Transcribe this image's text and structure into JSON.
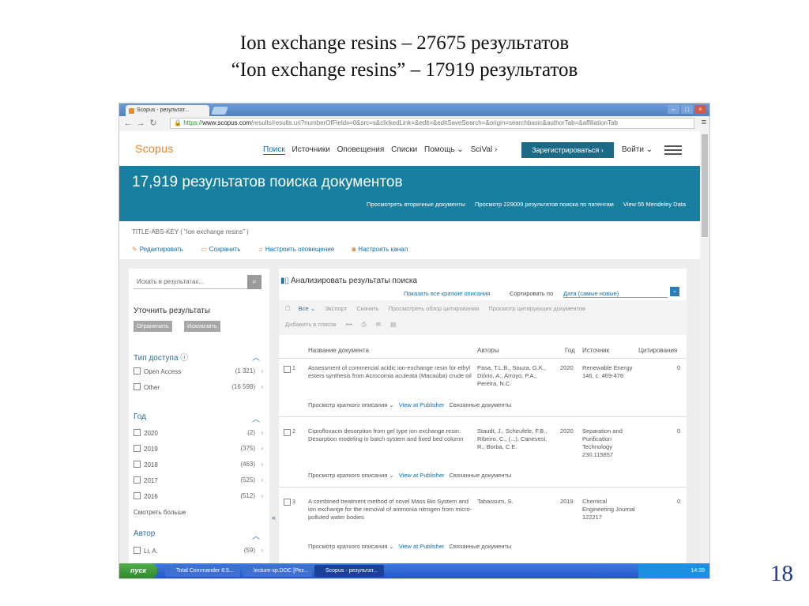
{
  "slide": {
    "title_line1": "Ion exchange resins – 27675 результатов",
    "title_line2": "“Ion exchange resins” – 17919 результатов",
    "page_number": "18"
  },
  "browser": {
    "tab_title": "Scopus - результат...",
    "url_https": "https://",
    "url_host": "www.scopus.com",
    "url_rest": "/results/results.uri?numberOfFields=0&src=s&clickedLink=&edit=&editSaveSearch=&origin=searchbasic&authorTab=&affiliationTab"
  },
  "header": {
    "logo": "Scopus",
    "nav": [
      "Поиск",
      "Источники",
      "Оповещения",
      "Списки",
      "Помощь ⌄",
      "SciVal ›"
    ],
    "register_label": "Зарегистрироваться ›",
    "login_label": "Войти ⌄"
  },
  "banner": {
    "title": "17,919 результатов поиска документов",
    "link1": "Просмотреть вторичные документы",
    "link2": "Просмотр 229009 результатов поиска по патентам",
    "link3": "View 55 Mendeley Data"
  },
  "query": "TITLE-ABS-KEY ( \"ion exchange resins\" )",
  "actions": {
    "edit": "Редактировать",
    "save": "Сохранить",
    "alert": "Настроить оповещение",
    "feed": "Настроить канал"
  },
  "left": {
    "search_placeholder": "Искать в результатах...",
    "refine_title": "Уточнить результаты",
    "limit_btn": "Ограничить",
    "exclude_btn": "Исключить",
    "access_title": "Тип доступа",
    "access": [
      {
        "label": "Open Access",
        "count": "(1 321)"
      },
      {
        "label": "Other",
        "count": "(16 598)"
      }
    ],
    "year_title": "Год",
    "years": [
      {
        "label": "2020",
        "count": "(2)"
      },
      {
        "label": "2019",
        "count": "(375)"
      },
      {
        "label": "2018",
        "count": "(463)"
      },
      {
        "label": "2017",
        "count": "(525)"
      },
      {
        "label": "2016",
        "count": "(512)"
      }
    ],
    "more_label": "Смотреть больше",
    "author_title": "Автор",
    "authors": [
      {
        "label": "Li, A.",
        "count": "(59)"
      }
    ]
  },
  "results": {
    "analyze": "Анализировать результаты поиска",
    "show_all": "Показать все краткие описания",
    "sort_label": "Сортировать по",
    "sort_value": "Дата (самые новые)",
    "toolbar1": [
      "Все ⌄",
      "Экспорт",
      "Скачать",
      "Просмотреть обзор цитирования",
      "Просмотр цитирующих документов"
    ],
    "toolbar2": [
      "Добавить в список",
      "•••",
      "⎙",
      "✉",
      "▤"
    ],
    "headers": {
      "title": "Название документа",
      "authors": "Авторы",
      "year": "Год",
      "source": "Источник",
      "cited": "Цитирования"
    },
    "rows": [
      {
        "no": "1",
        "title": "Assessment of commercial acidic ion-exchange resin for ethyl esters synthesis from Acrocomia aculeata (Macaúba) crude oil",
        "authors": "Pasa, T.L.B., Souza, G.K., Diório, A., Arroyo, P.A., Pereira, N.C.",
        "year": "2020",
        "source": "Renewable Energy 146, с. 469-476",
        "cited": "0"
      },
      {
        "no": "2",
        "title": "Ciprofloxacin desorption from gel type ion exchange resin: Desorption modeling in batch system and fixed bed column",
        "authors": "Staudt, J., Scheufele, F.B., Ribeiro, C., (...), Canevesi, R., Borba, C.E.",
        "year": "2020",
        "source": "Separation and Purification Technology 230,115857",
        "cited": "0"
      },
      {
        "no": "3",
        "title": "A combined treatment method of novel Mass Bio System and ion exchange for the removal of ammonia nitrogen from micro-polluted water bodies",
        "authors": "Tabassum, S.",
        "year": "2019",
        "source": "Chemical Engineering Journal 122217",
        "cited": "0"
      }
    ],
    "row_link_abstract": "Просмотр краткого описания ⌄",
    "row_link_publisher": "View at Publisher",
    "row_link_related": "Связанные документы"
  },
  "taskbar": {
    "start": "пуск",
    "items": [
      "Total Commander 8.5...",
      "lecture-xp.DOC [Рез...",
      "Scopus - результат..."
    ],
    "clock": "14:39"
  }
}
